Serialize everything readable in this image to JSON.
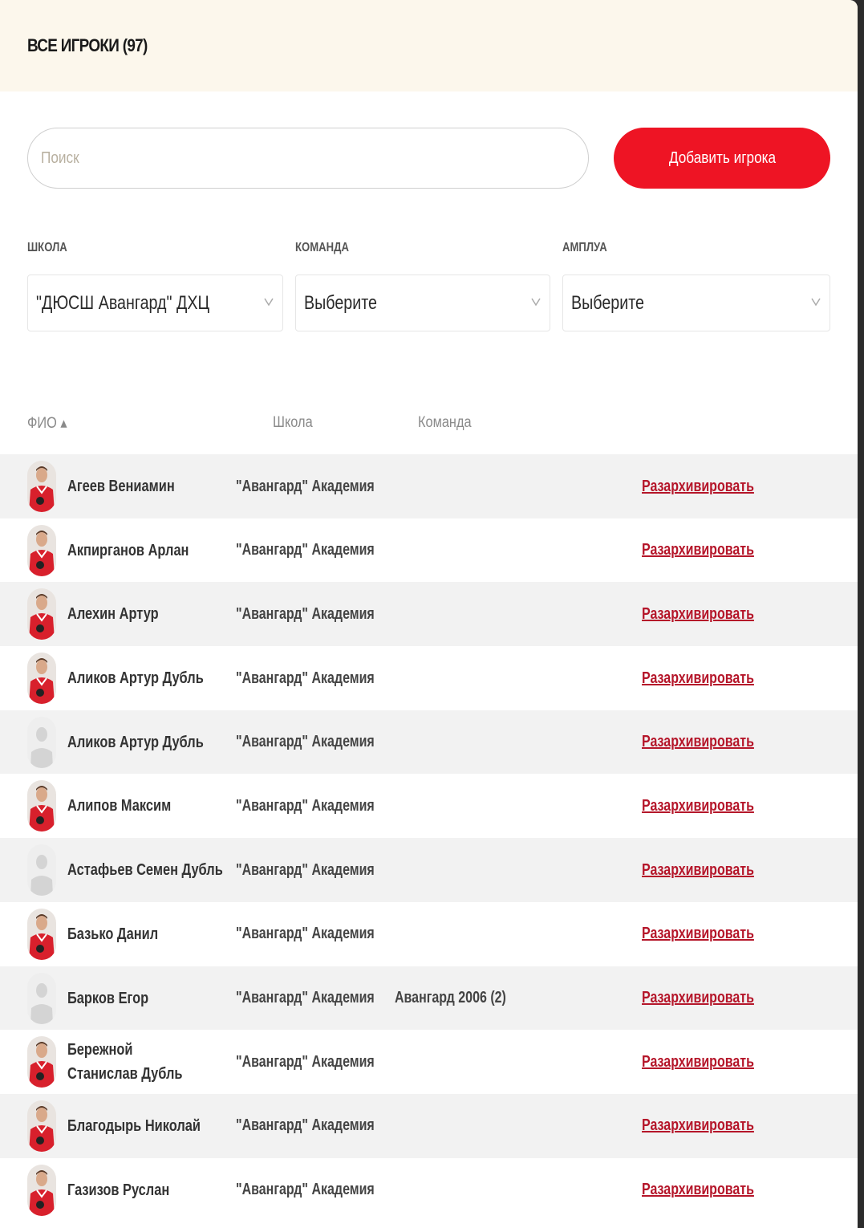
{
  "header": {
    "title": "ВСЕ ИГРОКИ (97)"
  },
  "search": {
    "placeholder": "Поиск"
  },
  "add_button": {
    "label": "Добавить игрока"
  },
  "filters": {
    "school": {
      "label": "ШКОЛА",
      "value": "\"ДЮСШ Авангард\" ДХЦ"
    },
    "team": {
      "label": "КОМАНДА",
      "value": "Выберите"
    },
    "position": {
      "label": "АМПЛУА",
      "value": "Выберите"
    }
  },
  "columns": {
    "name": "ФИО ▴",
    "school": "Школа",
    "team": "Команда"
  },
  "colors": {
    "accent": "#ee1424",
    "link": "#b5162a",
    "header_bg": "#fcf7ec",
    "row_alt": "#f2f2f2"
  },
  "rows": [
    {
      "name": "Агеев Вениамин",
      "school": "\"Авангард\" Академия",
      "team": "",
      "action": "Разархивировать",
      "avatar": "photo"
    },
    {
      "name": "Акпирганов Арлан",
      "school": "\"Авангард\" Академия",
      "team": "",
      "action": "Разархивировать",
      "avatar": "photo"
    },
    {
      "name": "Алехин Артур",
      "school": "\"Авангард\" Академия",
      "team": "",
      "action": "Разархивировать",
      "avatar": "photo"
    },
    {
      "name": "Аликов Артур Дубль",
      "school": "\"Авангард\" Академия",
      "team": "",
      "action": "Разархивировать",
      "avatar": "photo"
    },
    {
      "name": "Аликов Артур Дубль",
      "school": "\"Авангард\" Академия",
      "team": "",
      "action": "Разархивировать",
      "avatar": "placeholder"
    },
    {
      "name": "Алипов Максим",
      "school": "\"Авангард\" Академия",
      "team": "",
      "action": "Разархивировать",
      "avatar": "photo"
    },
    {
      "name": "Астафьев Семен Дубль",
      "school": "\"Авангард\" Академия",
      "team": "",
      "action": "Разархивировать",
      "avatar": "placeholder"
    },
    {
      "name": "Базько Данил",
      "school": "\"Авангард\" Академия",
      "team": "",
      "action": "Разархивировать",
      "avatar": "photo"
    },
    {
      "name": "Барков Егор",
      "school": "\"Авангард\" Академия",
      "team": "Авангард 2006 (2)",
      "action": "Разархивировать",
      "avatar": "placeholder"
    },
    {
      "name": "Бережной Станислав Дубль",
      "school": "\"Авангард\" Академия",
      "team": "",
      "action": "Разархивировать",
      "avatar": "photo"
    },
    {
      "name": "Благодырь Николай",
      "school": "\"Авангард\" Академия",
      "team": "",
      "action": "Разархивировать",
      "avatar": "photo"
    },
    {
      "name": "Газизов Руслан",
      "school": "\"Авангард\" Академия",
      "team": "",
      "action": "Разархивировать",
      "avatar": "photo"
    }
  ]
}
